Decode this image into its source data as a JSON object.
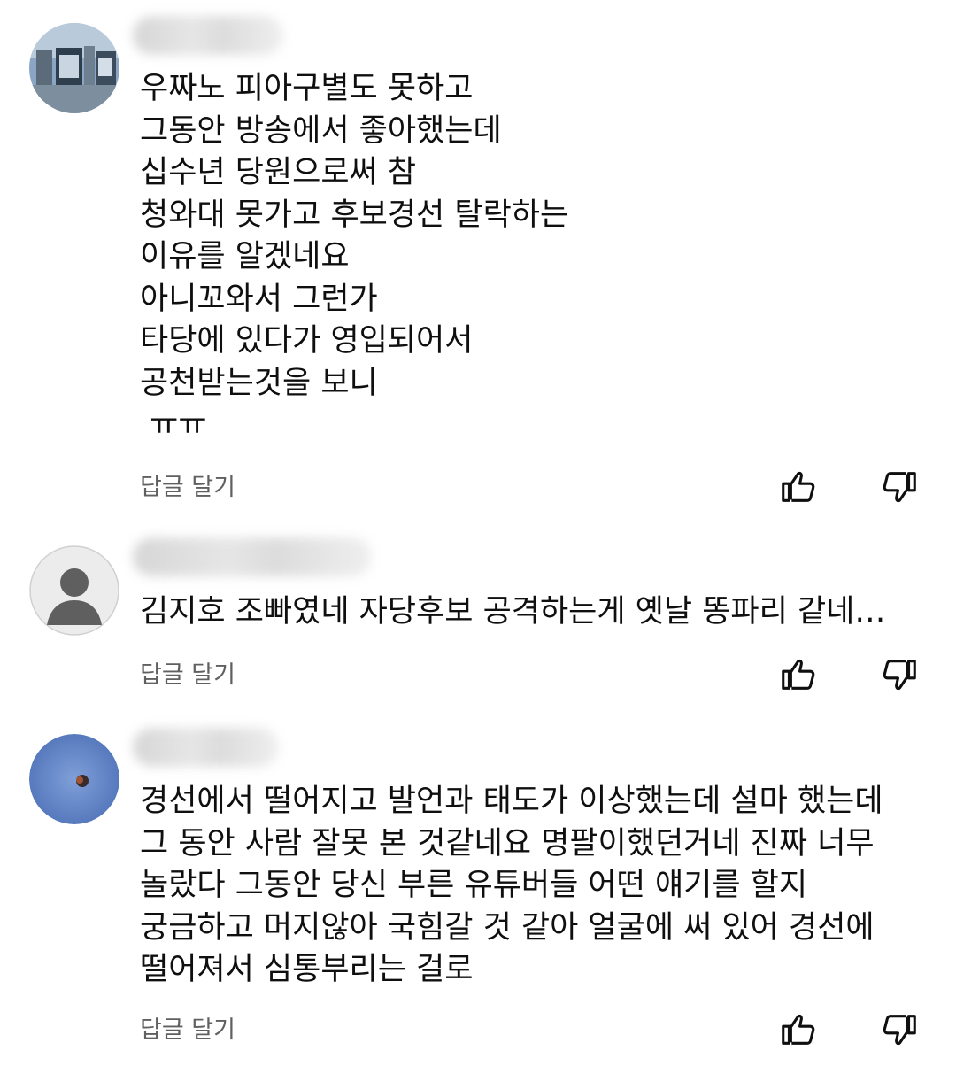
{
  "comments": [
    {
      "avatar": "photo-avatar",
      "text": "우짜노 피아구별도 못하고\n그동안 방송에서 좋아했는데\n십수년 당원으로써 참\n청와대 못가고 후보경선 탈락하는\n이유를 알겠네요\n아니꼬와서 그런가\n타당에 있다가 영입되어서\n공천받는것을 보니\n ㅠㅠ",
      "reply_label": "답글 달기",
      "like_icon": "thumbs-up-icon",
      "dislike_icon": "thumbs-down-icon"
    },
    {
      "avatar": "default-person-avatar",
      "text": "김지호 조빠였네 자당후보 공격하는게 옛날 똥파리 같네…",
      "reply_label": "답글 달기",
      "like_icon": "thumbs-up-icon",
      "dislike_icon": "thumbs-down-icon"
    },
    {
      "avatar": "sky-moon-avatar",
      "text": "경선에서 떨어지고 발언과 태도가 이상했는데 설마 했는데\n그 동안 사람 잘못 본 것같네요 명팔이했던거네 진짜 너무\n놀랐다 그동안 당신 부른 유튜버들 어떤 얘기를 할지\n궁금하고 머지않아 국힘갈 것 같아 얼굴에 써 있어 경선에\n떨어져서 심통부리는 걸로",
      "reply_label": "답글 달기",
      "like_icon": "thumbs-up-icon",
      "dislike_icon": "thumbs-down-icon"
    }
  ],
  "colors": {
    "text": "#0f0f0f",
    "secondary": "#606060",
    "background": "#ffffff"
  }
}
